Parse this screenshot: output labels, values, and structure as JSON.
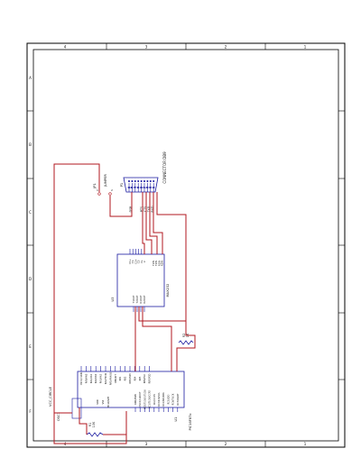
{
  "colors": {
    "border": "#000000",
    "wire": "#b0171f",
    "part": "#1a1aa0",
    "text": "#111111"
  },
  "frame": {
    "zone_numbers": [
      "4",
      "3",
      "2",
      "1"
    ],
    "zone_letters": [
      "A",
      "B",
      "C",
      "D",
      "E",
      "F"
    ]
  },
  "connector": {
    "ref": "P1",
    "name": "CONNECTOR DB9",
    "pins": [
      "5",
      "9",
      "4",
      "8",
      "3",
      "7",
      "2",
      "6",
      "1"
    ]
  },
  "jumper": {
    "ref": "JP1",
    "name": "JUMPER",
    "pins": [
      "1",
      "2"
    ]
  },
  "max232": {
    "ref": "U3",
    "name": "MAX232",
    "left_pins": [
      "T1OUT",
      "T2OUT",
      "R1OUT",
      "R2OUT"
    ],
    "top_pins": [
      "C1+",
      "C1-",
      "C2+",
      "C2-",
      "V+",
      "V-"
    ],
    "right_pins": [
      "T1IN",
      "T2IN",
      "R1IN",
      "R2IN"
    ]
  },
  "pic": {
    "ref": "U1",
    "name": "PIC16F87x",
    "left_pins": [
      "RD0/PSP0",
      "OSC2/CLKOUT",
      "RC0/T1OSO/T1CKI",
      "RC1/T1OSI/CCP2",
      "RC2/CCP1",
      "RC3/SCK/SCL",
      "RC4/SDI/SDA",
      "RC5/SDO",
      "RC6/TX/CK",
      "RC7/RX/DT"
    ],
    "right_pins": [
      "OSC1/CLKIN",
      "RA0/AN0",
      "RA1/AN1",
      "RA2/AN2",
      "RA3/AN3",
      "RA4/T0CKI",
      "RA5/AN4/SS",
      "RB0/INT",
      "RB1",
      "RB2",
      "RB3/PGM",
      "RB4",
      "RB5",
      "RB6/PGC",
      "RB7/PGD"
    ],
    "bottom_pins": [
      "VDD",
      "VSS",
      "MCLR/VPP"
    ]
  },
  "r1": {
    "ref": "R1",
    "value": "10K"
  },
  "r2": {
    "ref": "R2",
    "value": "1K"
  },
  "osc": {
    "ref": "OSC1"
  },
  "power": {
    "net": "VCC_CIRCLE"
  },
  "nets": [
    "DSR",
    "RTS",
    "CTS",
    "TXD",
    "RXD"
  ]
}
